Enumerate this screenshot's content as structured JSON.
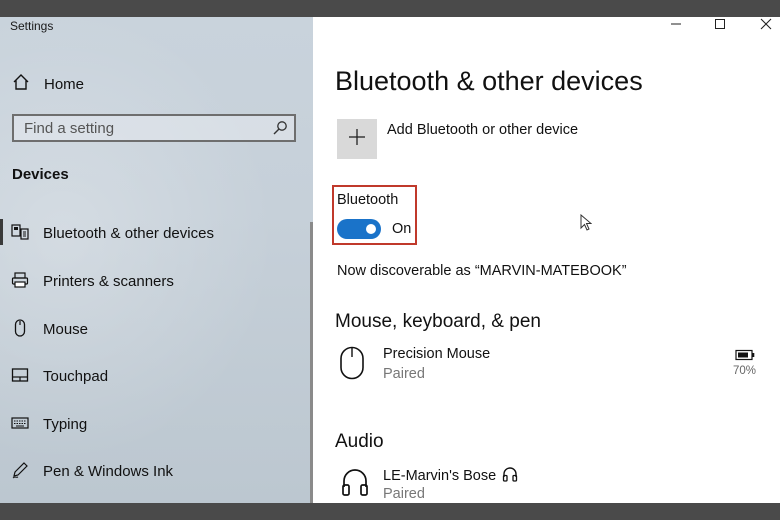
{
  "window": {
    "title": "Settings"
  },
  "sidebar": {
    "home_label": "Home",
    "search_placeholder": "Find a setting",
    "section_heading": "Devices",
    "items": [
      {
        "label": "Bluetooth & other devices",
        "icon": "bluetooth-devices-icon",
        "active": true
      },
      {
        "label": "Printers & scanners",
        "icon": "printer-icon"
      },
      {
        "label": "Mouse",
        "icon": "mouse-icon"
      },
      {
        "label": "Touchpad",
        "icon": "touchpad-icon"
      },
      {
        "label": "Typing",
        "icon": "keyboard-icon"
      },
      {
        "label": "Pen & Windows Ink",
        "icon": "pen-icon"
      }
    ]
  },
  "main": {
    "title": "Bluetooth & other devices",
    "add_device_label": "Add Bluetooth or other device",
    "bluetooth": {
      "label": "Bluetooth",
      "state_label": "On"
    },
    "discoverable_text": "Now discoverable as “MARVIN-MATEBOOK”",
    "groups": [
      {
        "heading": "Mouse, keyboard, & pen",
        "devices": [
          {
            "name": "Precision Mouse",
            "status": "Paired",
            "battery": "70%"
          }
        ]
      },
      {
        "heading": "Audio",
        "devices": [
          {
            "name": "LE-Marvin's Bose",
            "status": "Paired"
          }
        ]
      }
    ]
  },
  "colors": {
    "accent": "#1a73c9",
    "highlight_border": "#c0392b",
    "sidebar_bg": "#c6d0d9"
  }
}
